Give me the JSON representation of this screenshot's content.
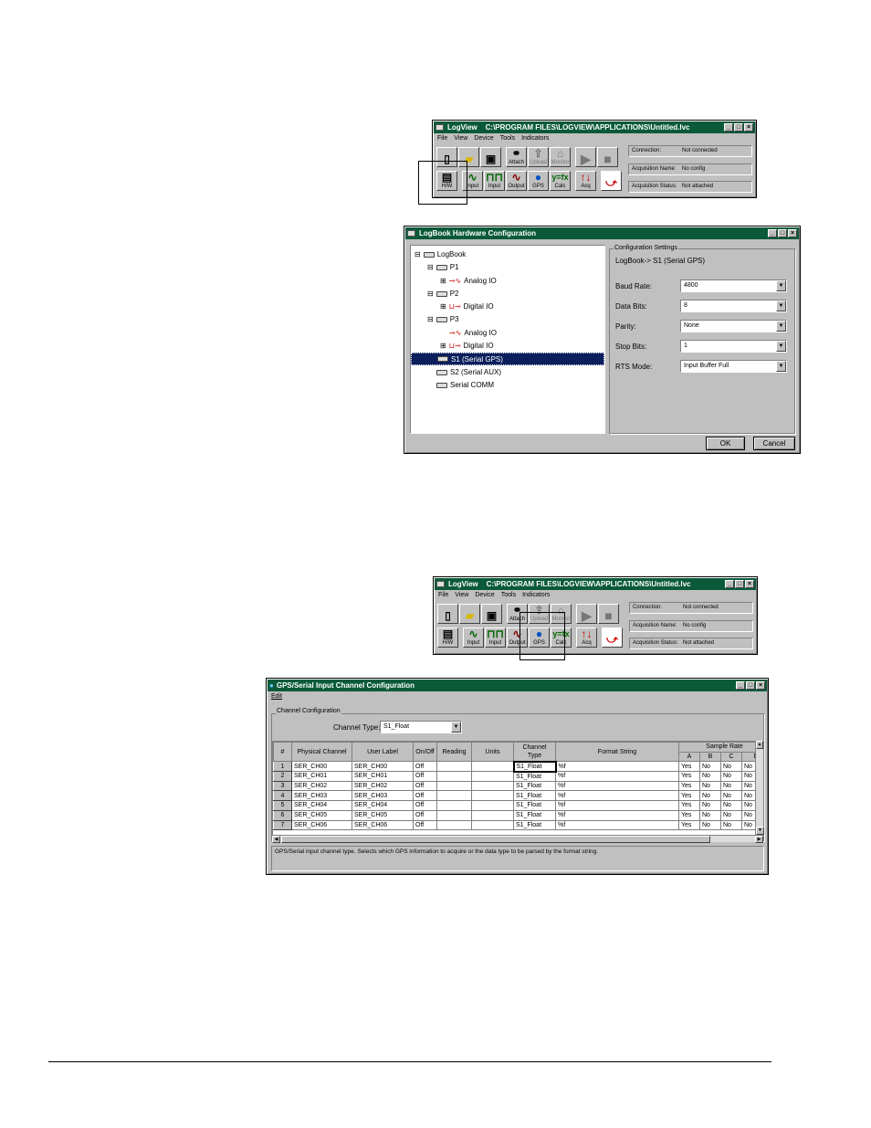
{
  "logview1": {
    "app_name": "LogView",
    "path": "C:\\PROGRAM FILES\\LOGVIEW\\APPLICATIONS\\Untitled.lvc",
    "menu": [
      "File",
      "View",
      "Device",
      "Tools",
      "Indicators"
    ],
    "buttons_row1": [
      "Attach",
      "Upload",
      "Monitor"
    ],
    "buttons_row2": [
      "H/W",
      "Input",
      "Input",
      "Output",
      "GPS",
      "Calc",
      "Acq"
    ],
    "status": {
      "connection_label": "Connection:",
      "connection_value": "Not connected",
      "acq_name_label": "Acquisition Name:",
      "acq_name_value": "No config",
      "acq_status_label": "Acquisition Status:",
      "acq_status_value": "Not attached"
    }
  },
  "hwconfig": {
    "title": "LogBook Hardware Configuration",
    "tree": [
      "LogBook",
      "P1",
      "Analog IO",
      "P2",
      "Digital IO",
      "P3",
      "Analog IO",
      "Digital IO",
      "S1 (Serial GPS)",
      "S2 (Serial AUX)",
      "Serial COMM"
    ],
    "settings_group": "Configuration Settings",
    "settings_path": "LogBook-> S1 (Serial GPS)",
    "fields": [
      {
        "label": "Baud Rate:",
        "value": "4800"
      },
      {
        "label": "Data Bits:",
        "value": "8"
      },
      {
        "label": "Parity:",
        "value": "None"
      },
      {
        "label": "Stop Bits:",
        "value": "1"
      },
      {
        "label": "RTS Mode:",
        "value": "Input Buffer Full"
      }
    ],
    "ok": "OK",
    "cancel": "Cancel"
  },
  "logview2": {
    "app_name": "LogView",
    "path": "C:\\PROGRAM FILES\\LOGVIEW\\APPLICATIONS\\Untitled.lvc",
    "menu": [
      "File",
      "View",
      "Device",
      "Tools",
      "Indicators"
    ],
    "buttons_row1": [
      "Attach",
      "Upload",
      "Monitor"
    ],
    "buttons_row2": [
      "H/W",
      "Input",
      "Input",
      "Output",
      "GPS",
      "Calc",
      "Acq"
    ],
    "status": {
      "connection_label": "Connection:",
      "connection_value": "Not connected",
      "acq_name_label": "Acquisition Name:",
      "acq_name_value": "No config",
      "acq_status_label": "Acquisition Status:",
      "acq_status_value": "Not attached"
    }
  },
  "gpsconfig": {
    "title": "GPS/Serial Input Channel Configuration",
    "menu_edit": "Edit",
    "group": "Channel Configuration",
    "channel_type_label": "Channel Type:",
    "channel_type_value": "S1_Float",
    "headers": [
      "#",
      "Physical Channel",
      "User Label",
      "On/Off",
      "Reading",
      "Units",
      "Channel Type",
      "Format String"
    ],
    "sample_rate": "Sample Rate",
    "sample_cols": [
      "A",
      "B",
      "C",
      "D"
    ],
    "rows": [
      [
        "1",
        "SER_CH00",
        "SER_CH00",
        "Off",
        "",
        "",
        "S1_Float",
        "%f",
        "Yes",
        "No",
        "No",
        "No"
      ],
      [
        "2",
        "SER_CH01",
        "SER_CH01",
        "Off",
        "",
        "",
        "S1_Float",
        "%f",
        "Yes",
        "No",
        "No",
        "No"
      ],
      [
        "3",
        "SER_CH02",
        "SER_CH02",
        "Off",
        "",
        "",
        "S1_Float",
        "%f",
        "Yes",
        "No",
        "No",
        "No"
      ],
      [
        "4",
        "SER_CH03",
        "SER_CH03",
        "Off",
        "",
        "",
        "S1_Float",
        "%f",
        "Yes",
        "No",
        "No",
        "No"
      ],
      [
        "5",
        "SER_CH04",
        "SER_CH04",
        "Off",
        "",
        "",
        "S1_Float",
        "%f",
        "Yes",
        "No",
        "No",
        "No"
      ],
      [
        "6",
        "SER_CH05",
        "SER_CH05",
        "Off",
        "",
        "",
        "S1_Float",
        "%f",
        "Yes",
        "No",
        "No",
        "No"
      ],
      [
        "7",
        "SER_CH06",
        "SER_CH06",
        "Off",
        "",
        "",
        "S1_Float",
        "%f",
        "Yes",
        "No",
        "No",
        "No"
      ]
    ],
    "status_text": "GPS/Serial input channel type. Selects which GPS information to acquire or the data type to be parsed by the format string."
  }
}
